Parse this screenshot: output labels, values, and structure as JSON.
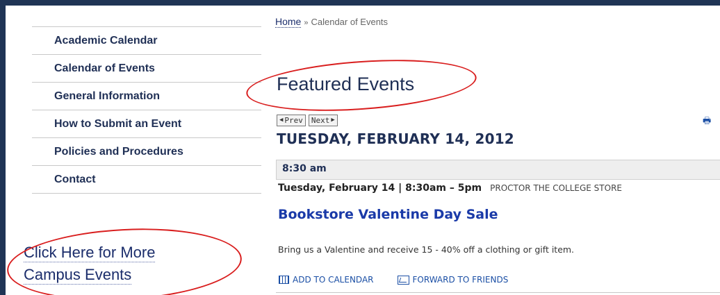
{
  "sidebar": {
    "items": [
      {
        "label": "Academic Calendar"
      },
      {
        "label": "Calendar of Events"
      },
      {
        "label": "General Information"
      },
      {
        "label": "How to Submit an Event"
      },
      {
        "label": "Policies and Procedures"
      },
      {
        "label": "Contact"
      }
    ],
    "more_link": {
      "line1": "Click Here for More",
      "line2": "Campus Events"
    }
  },
  "breadcrumb": {
    "home": "Home",
    "separator": "»",
    "current": "Calendar of Events"
  },
  "featured_title": "Featured Events",
  "pager": {
    "prev": "Prev",
    "next": "Next",
    "print_icon": "printer-icon"
  },
  "date_heading": "TUESDAY, FEBRUARY 14, 2012",
  "time_label": "8:30 am",
  "event": {
    "when": "Tuesday, February 14 | 8:30am – 5pm",
    "where": "PROCTOR THE COLLEGE STORE",
    "title": "Bookstore Valentine Day Sale",
    "description": "Bring us a Valentine and receive 15 - 40% off a clothing or gift item.",
    "add_to_calendar": "ADD TO CALENDAR",
    "forward": "FORWARD TO FRIENDS"
  },
  "colors": {
    "frame": "#1f3455",
    "annotation": "#d91e1e",
    "link": "#1a3aa8",
    "heading": "#1f2f55"
  }
}
